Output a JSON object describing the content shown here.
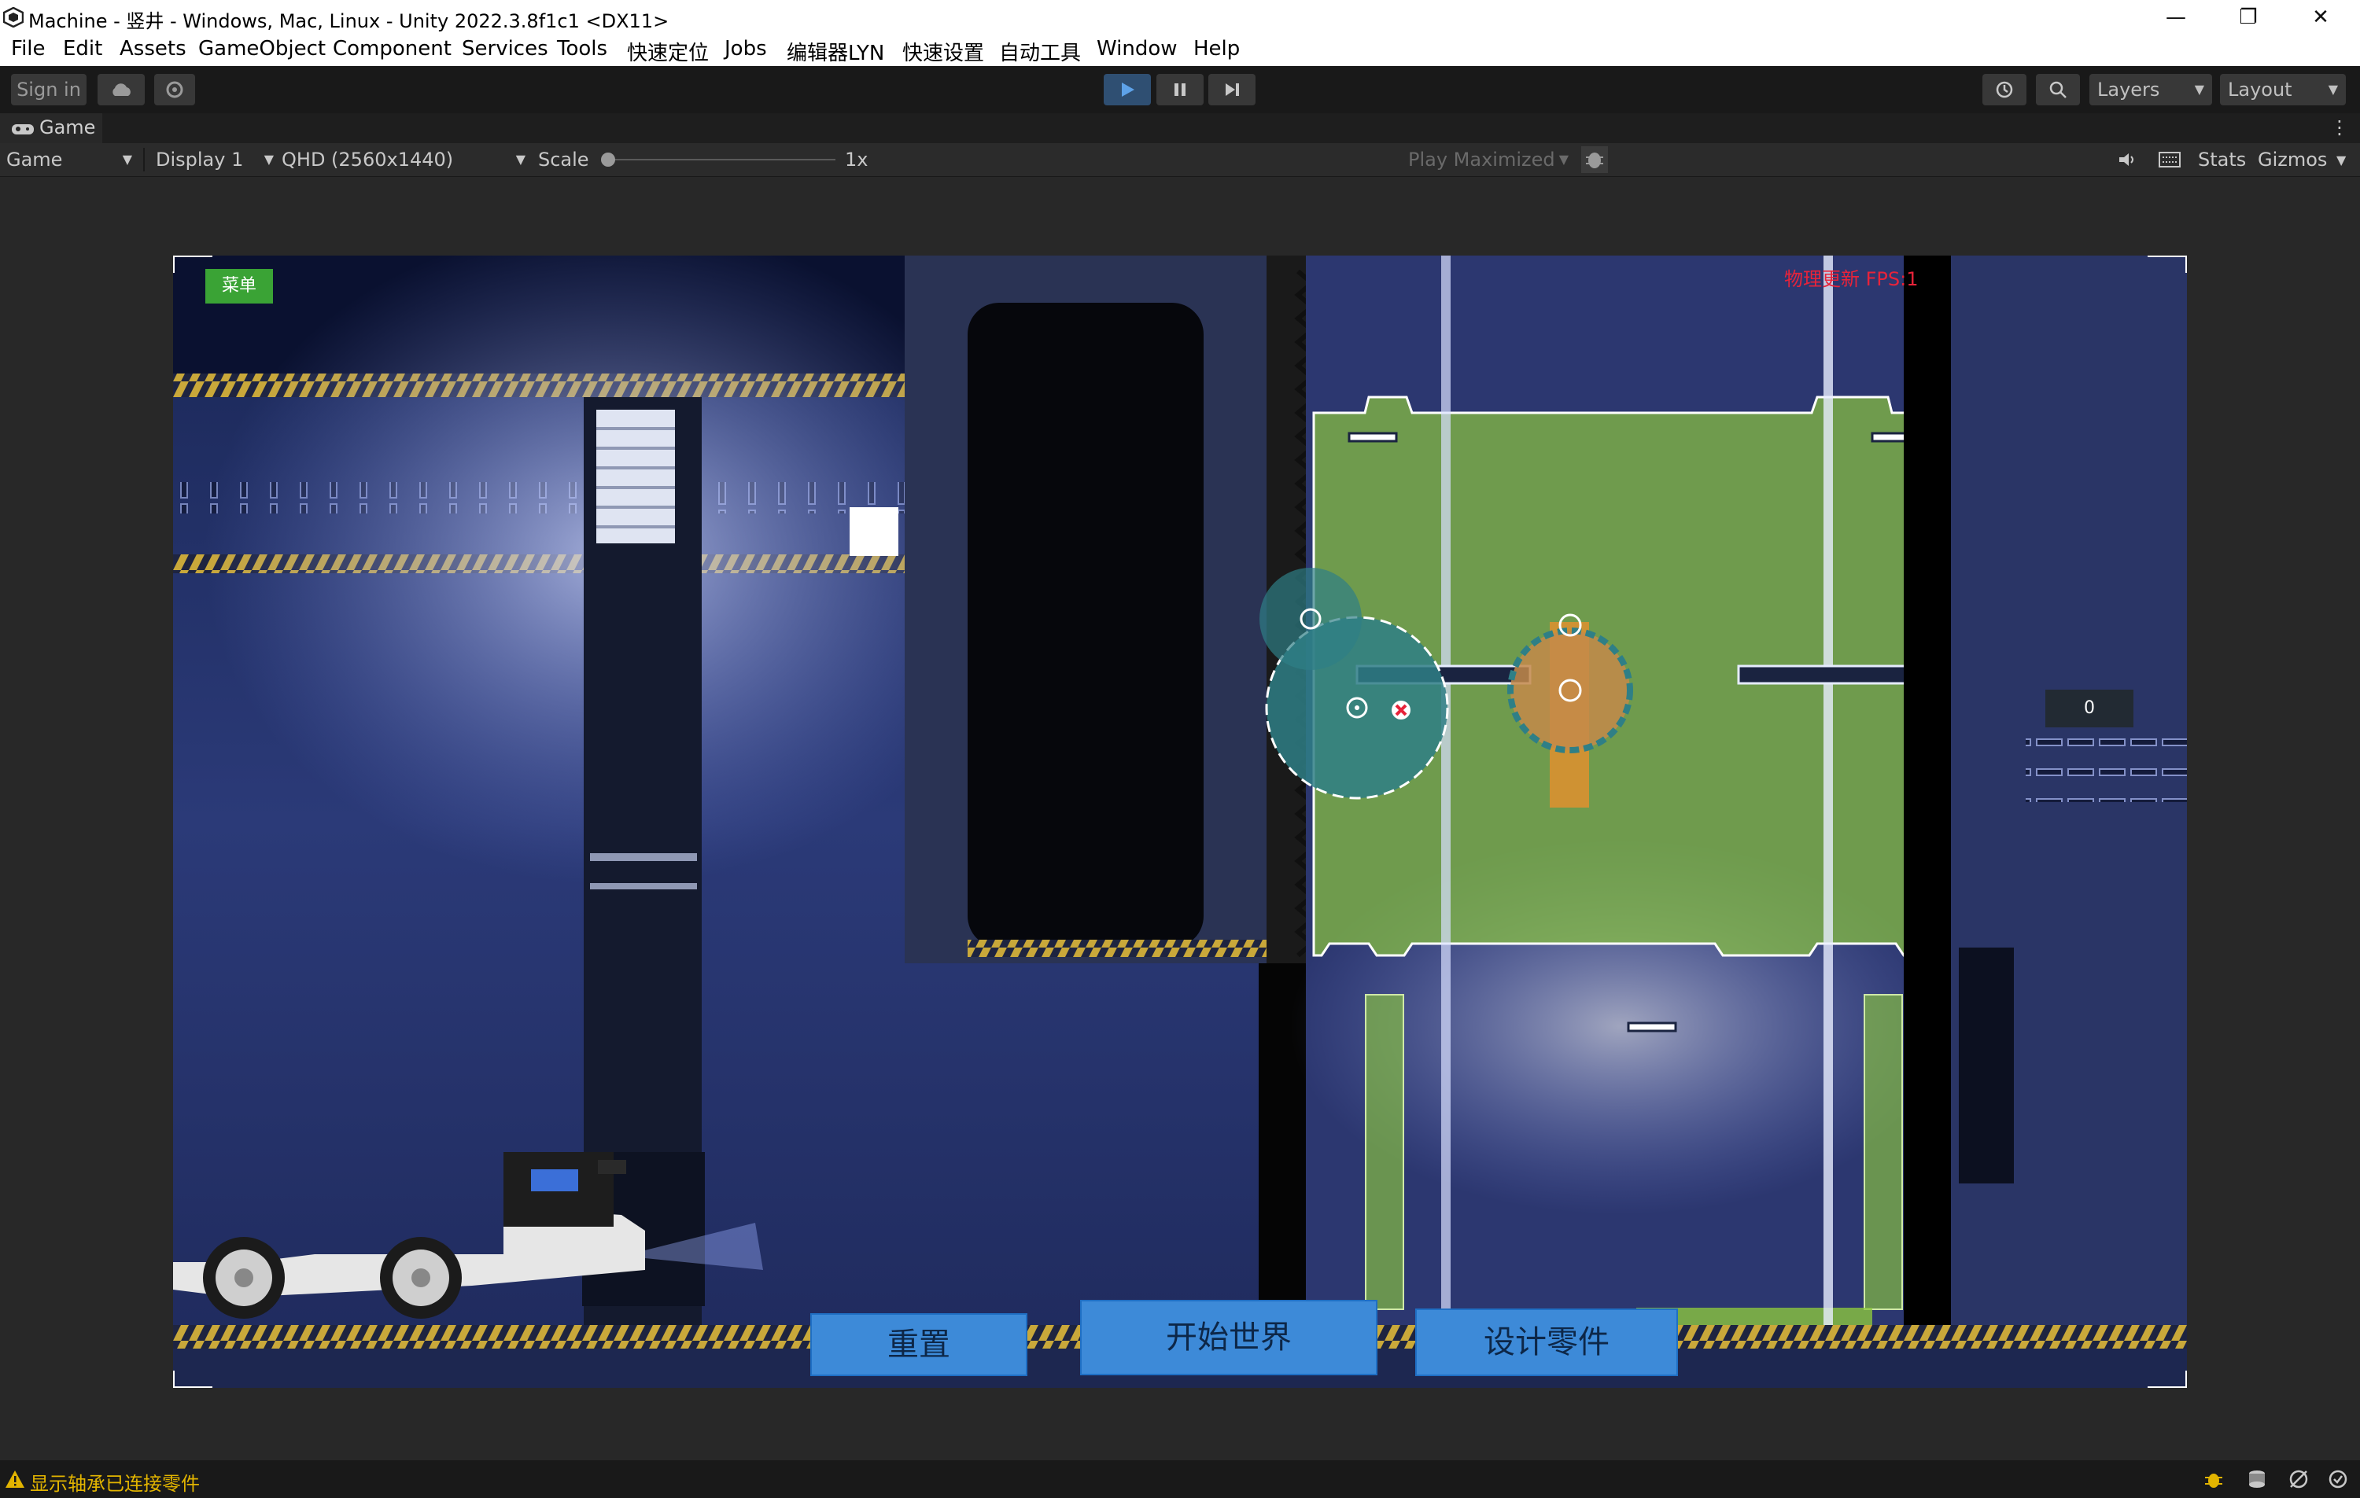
{
  "window": {
    "title": "Machine - 竖井 - Windows, Mac, Linux - Unity 2022.3.8f1c1 <DX11>",
    "minimize_glyph": "—",
    "restore_glyph": "❐",
    "close_glyph": "✕"
  },
  "menu": [
    "File",
    "Edit",
    "Assets",
    "GameObject",
    "Component",
    "Services",
    "Tools",
    "快速定位",
    "Jobs",
    "编辑器LYN",
    "快速设置",
    "自动工具",
    "Window",
    "Help"
  ],
  "toolbar": {
    "sign_in": "Sign in",
    "layers": "Layers",
    "layout": "Layout"
  },
  "game_tab": {
    "label": "Game",
    "mode": "Game",
    "display": "Display 1",
    "resolution": "QHD (2560x1440)",
    "scale_label": "Scale",
    "scale_value": "1x",
    "play_mode": "Play Maximized",
    "stats": "Stats",
    "gizmos": "Gizmos"
  },
  "game": {
    "menu_button": "菜单",
    "fps_text": "物理更新 FPS:1",
    "counter": "0",
    "buttons": {
      "reset": "重置",
      "start": "开始世界",
      "design": "设计零件"
    }
  },
  "status": {
    "message": "显示轴承已连接零件"
  },
  "colors": {
    "accent_blue": "#3d8ad8",
    "machine_green": "#8cc63f",
    "menu_green": "#3aa335",
    "fps_red": "#e8233a"
  }
}
